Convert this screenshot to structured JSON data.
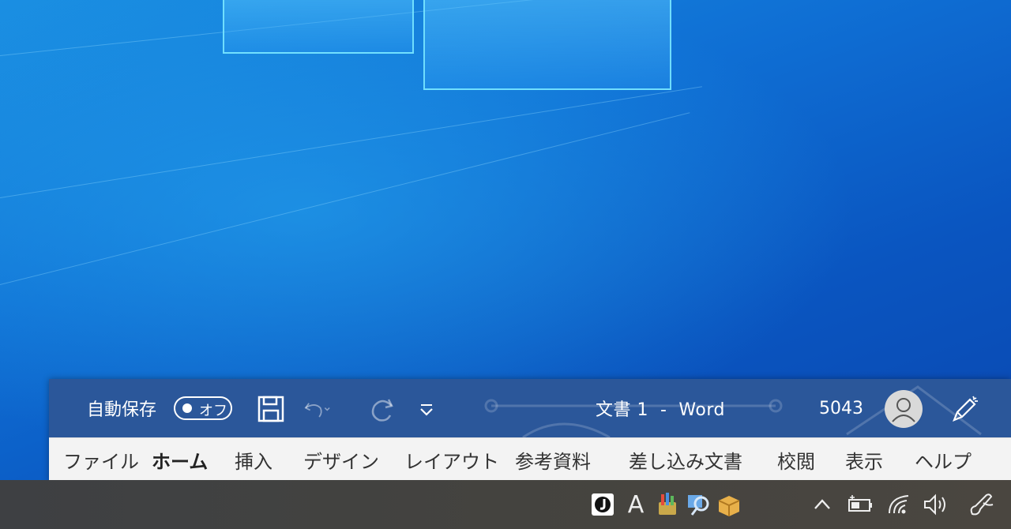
{
  "window": {
    "title": "文書 1  -  Word",
    "user_name": "5043",
    "accent": "#2b579a"
  },
  "quick_access": {
    "autosave_label": "自動保存",
    "autosave_state": "オフ",
    "icons": [
      "save-icon",
      "undo-icon",
      "redo-icon",
      "customize-toolbar-icon"
    ]
  },
  "ribbon": {
    "tabs": [
      {
        "label": "ファイル"
      },
      {
        "label": "ホーム",
        "active": true
      },
      {
        "label": "挿入"
      },
      {
        "label": "デザイン"
      },
      {
        "label": "レイアウト"
      },
      {
        "label": "参考資料"
      },
      {
        "label": "差し込み文書"
      },
      {
        "label": "校閲"
      },
      {
        "label": "表示"
      },
      {
        "label": "ヘルプ"
      }
    ]
  },
  "taskbar": {
    "ime_mode": "A",
    "tray_icons": [
      "ime-j-icon",
      "ime-mode-icon",
      "app-tray-icon",
      "search-tool-icon",
      "package-icon",
      "show-hidden-icons-chevron",
      "battery-icon",
      "wifi-icon",
      "volume-icon",
      "pen-workspace-icon"
    ]
  }
}
